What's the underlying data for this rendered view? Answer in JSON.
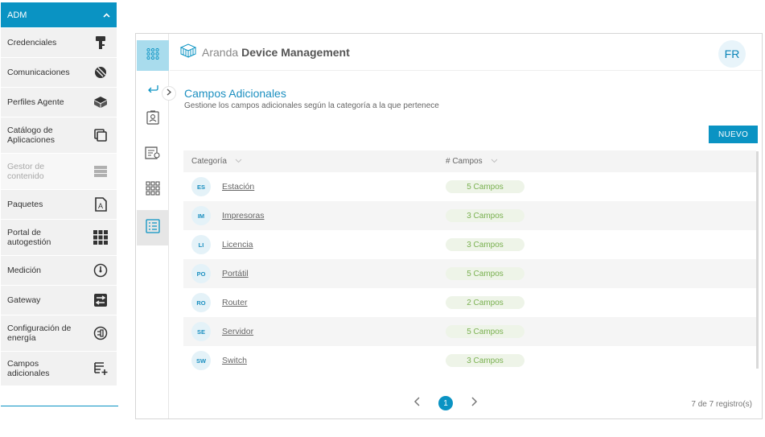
{
  "sidebar": {
    "section_label": "ADM",
    "items": [
      {
        "label": "Credenciales",
        "icon": "key-icon",
        "disabled": false
      },
      {
        "label": "Comunicaciones",
        "icon": "satellite-icon",
        "disabled": false
      },
      {
        "label": "Perfiles Agente",
        "icon": "box-icon",
        "disabled": false
      },
      {
        "label": "Catálogo de Aplicaciones",
        "icon": "catalog-icon",
        "disabled": false
      },
      {
        "label": "Gestor de contenido",
        "icon": "server-icon",
        "disabled": true
      },
      {
        "label": "Paquetes",
        "icon": "package-icon",
        "disabled": false
      },
      {
        "label": "Portal de autogestión",
        "icon": "grid-icon",
        "disabled": false
      },
      {
        "label": "Medición",
        "icon": "gauge-icon",
        "disabled": false
      },
      {
        "label": "Gateway",
        "icon": "gateway-icon",
        "disabled": false
      },
      {
        "label": "Configuración de energía",
        "icon": "energy-icon",
        "disabled": false
      },
      {
        "label": "Campos adicionales",
        "icon": "add-field-icon",
        "disabled": false
      }
    ]
  },
  "header": {
    "brand_light": "Aranda",
    "brand_strong": "Device Management",
    "user_initials": "FR"
  },
  "page": {
    "title": "Campos Adicionales",
    "subtitle": "Gestione los campos adicionales según la categoría a la que pertenece",
    "new_button": "NUEVO"
  },
  "table": {
    "columns": [
      "Categoría",
      "# Campos"
    ],
    "rows": [
      {
        "abbr": "ES",
        "name": "Estación",
        "campos": "5 Campos"
      },
      {
        "abbr": "IM",
        "name": "Impresoras",
        "campos": "3 Campos"
      },
      {
        "abbr": "LI",
        "name": "Licencia",
        "campos": "3 Campos"
      },
      {
        "abbr": "PO",
        "name": "Portátil",
        "campos": "5 Campos"
      },
      {
        "abbr": "RO",
        "name": "Router",
        "campos": "2 Campos"
      },
      {
        "abbr": "SE",
        "name": "Servidor",
        "campos": "5 Campos"
      },
      {
        "abbr": "SW",
        "name": "Switch",
        "campos": "3 Campos"
      }
    ]
  },
  "pagination": {
    "current_page": "1",
    "records": "7 de 7 registro(s)"
  },
  "colors": {
    "accent": "#0a93c3",
    "pill_text": "#79b04f",
    "pill_bg": "#eef4e8"
  }
}
